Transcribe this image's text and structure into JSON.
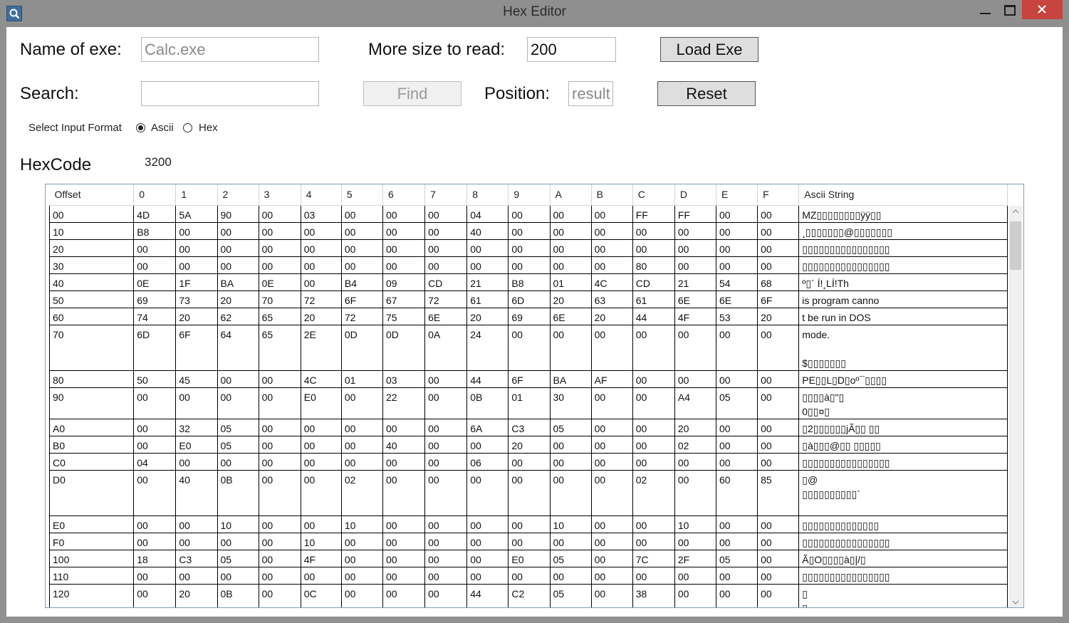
{
  "window": {
    "title": "Hex Editor",
    "icon": "magnifier-icon"
  },
  "form": {
    "name_label": "Name of exe:",
    "name_placeholder": "Calc.exe",
    "size_label": "More size to read:",
    "size_value": "200",
    "load_button": "Load Exe",
    "search_label": "Search:",
    "search_value": "",
    "find_button": "Find",
    "position_label": "Position:",
    "position_placeholder": "result",
    "reset_button": "Reset",
    "input_format_label": "Select Input Format",
    "format_options": [
      "Ascii",
      "Hex"
    ],
    "format_selected": "Ascii",
    "hexcode_label": "HexCode",
    "hexcode_value": "3200"
  },
  "grid": {
    "columns": [
      "Offset",
      "0",
      "1",
      "2",
      "3",
      "4",
      "5",
      "6",
      "7",
      "8",
      "9",
      "A",
      "B",
      "C",
      "D",
      "E",
      "F",
      "Ascii String"
    ],
    "rows": [
      [
        "00",
        "4D",
        "5A",
        "90",
        "00",
        "03",
        "00",
        "00",
        "00",
        "04",
        "00",
        "00",
        "00",
        "FF",
        "FF",
        "00",
        "00",
        "MZ▯▯▯▯▯▯▯▯ÿÿ▯▯"
      ],
      [
        "10",
        "B8",
        "00",
        "00",
        "00",
        "00",
        "00",
        "00",
        "00",
        "40",
        "00",
        "00",
        "00",
        "00",
        "00",
        "00",
        "00",
        "¸▯▯▯▯▯▯▯@▯▯▯▯▯▯▯"
      ],
      [
        "20",
        "00",
        "00",
        "00",
        "00",
        "00",
        "00",
        "00",
        "00",
        "00",
        "00",
        "00",
        "00",
        "00",
        "00",
        "00",
        "00",
        "▯▯▯▯▯▯▯▯▯▯▯▯▯▯▯▯"
      ],
      [
        "30",
        "00",
        "00",
        "00",
        "00",
        "00",
        "00",
        "00",
        "00",
        "00",
        "00",
        "00",
        "00",
        "80",
        "00",
        "00",
        "00",
        "▯▯▯▯▯▯▯▯▯▯▯▯▯▯▯▯"
      ],
      [
        "40",
        "0E",
        "1F",
        "BA",
        "0E",
        "00",
        "B4",
        "09",
        "CD",
        "21",
        "B8",
        "01",
        "4C",
        "CD",
        "21",
        "54",
        "68",
        "º▯´        Í!¸LÍ!Th"
      ],
      [
        "50",
        "69",
        "73",
        "20",
        "70",
        "72",
        "6F",
        "67",
        "72",
        "61",
        "6D",
        "20",
        "63",
        "61",
        "6E",
        "6E",
        "6F",
        "is program canno"
      ],
      [
        "60",
        "74",
        "20",
        "62",
        "65",
        "20",
        "72",
        "75",
        "6E",
        "20",
        "69",
        "6E",
        "20",
        "44",
        "4F",
        "53",
        "20",
        "t be run in DOS"
      ],
      [
        "70",
        "6D",
        "6F",
        "64",
        "65",
        "2E",
        "0D",
        "0D",
        "0A",
        "24",
        "00",
        "00",
        "00",
        "00",
        "00",
        "00",
        "00",
        "mode.\n\n$▯▯▯▯▯▯▯"
      ],
      [
        "80",
        "50",
        "45",
        "00",
        "00",
        "4C",
        "01",
        "03",
        "00",
        "44",
        "6F",
        "BA",
        "AF",
        "00",
        "00",
        "00",
        "00",
        "PE▯▯L▯D▯oº¯▯▯▯▯"
      ],
      [
        "90",
        "00",
        "00",
        "00",
        "00",
        "E0",
        "00",
        "22",
        "00",
        "0B",
        "01",
        "30",
        "00",
        "00",
        "A4",
        "05",
        "00",
        "▯▯▯▯à▯\"▯\n0▯▯¤▯"
      ],
      [
        "A0",
        "00",
        "32",
        "05",
        "00",
        "00",
        "00",
        "00",
        "00",
        "6A",
        "C3",
        "05",
        "00",
        "00",
        "20",
        "00",
        "00",
        "▯2▯▯▯▯▯▯jÃ▯▯ ▯▯"
      ],
      [
        "B0",
        "00",
        "E0",
        "05",
        "00",
        "00",
        "00",
        "40",
        "00",
        "00",
        "20",
        "00",
        "00",
        "00",
        "02",
        "00",
        "00",
        "▯à▯▯▯@▯▯ ▯▯▯▯▯"
      ],
      [
        "C0",
        "04",
        "00",
        "00",
        "00",
        "00",
        "00",
        "00",
        "00",
        "06",
        "00",
        "00",
        "00",
        "00",
        "00",
        "00",
        "00",
        "▯▯▯▯▯▯▯▯▯▯▯▯▯▯▯▯"
      ],
      [
        "D0",
        "00",
        "40",
        "0B",
        "00",
        "00",
        "02",
        "00",
        "00",
        "00",
        "00",
        "00",
        "00",
        "02",
        "00",
        "60",
        "85",
        "▯@\n▯▯▯▯▯▯▯▯▯▯`\n "
      ],
      [
        "E0",
        "00",
        "00",
        "10",
        "00",
        "00",
        "10",
        "00",
        "00",
        "00",
        "00",
        "10",
        "00",
        "00",
        "10",
        "00",
        "00",
        "▯▯▯▯▯▯▯▯▯▯▯▯▯▯"
      ],
      [
        "F0",
        "00",
        "00",
        "00",
        "00",
        "10",
        "00",
        "00",
        "00",
        "00",
        "00",
        "00",
        "00",
        "00",
        "00",
        "00",
        "00",
        "▯▯▯▯▯▯▯▯▯▯▯▯▯▯▯▯"
      ],
      [
        "100",
        "18",
        "C3",
        "05",
        "00",
        "4F",
        "00",
        "00",
        "00",
        "00",
        "E0",
        "05",
        "00",
        "7C",
        "2F",
        "05",
        "00",
        "Ã▯O▯▯▯▯à▯|/▯"
      ],
      [
        "110",
        "00",
        "00",
        "00",
        "00",
        "00",
        "00",
        "00",
        "00",
        "00",
        "00",
        "00",
        "00",
        "00",
        "00",
        "00",
        "00",
        "▯▯▯▯▯▯▯▯▯▯▯▯▯▯▯▯"
      ],
      [
        "120",
        "00",
        "20",
        "0B",
        "00",
        "0C",
        "00",
        "00",
        "00",
        "44",
        "C2",
        "05",
        "00",
        "38",
        "00",
        "00",
        "00",
        "▯\n▯"
      ]
    ]
  },
  "colors": {
    "title_bar": "#8f8f8f",
    "close_button": "#c7443f",
    "grid_border": "#7f9db9"
  }
}
